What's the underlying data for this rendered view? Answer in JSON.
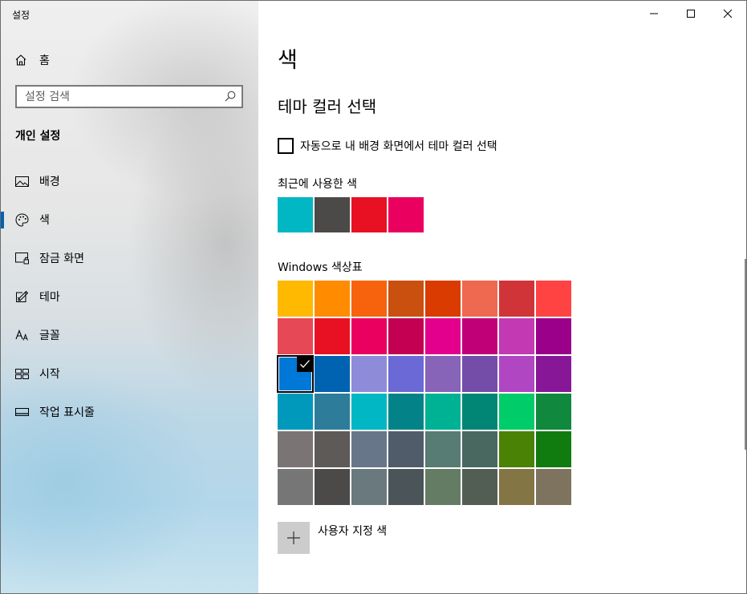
{
  "window": {
    "app_title": "설정"
  },
  "sidebar": {
    "home_label": "홈",
    "search": {
      "placeholder": "설정 검색"
    },
    "section_title": "개인 설정",
    "items": [
      {
        "label": "배경",
        "icon": "image-icon"
      },
      {
        "label": "색",
        "icon": "palette-icon",
        "active": true
      },
      {
        "label": "잠금 화면",
        "icon": "lock-screen-icon"
      },
      {
        "label": "테마",
        "icon": "theme-icon"
      },
      {
        "label": "글꼴",
        "icon": "font-icon"
      },
      {
        "label": "시작",
        "icon": "start-icon"
      },
      {
        "label": "작업 표시줄",
        "icon": "taskbar-icon"
      }
    ],
    "accent_color": "#0063b1"
  },
  "main": {
    "page_title": "색",
    "sub_title": "테마 컬러 선택",
    "auto_pick": {
      "label": "자동으로 내 배경 화면에서 테마 컬러 선택",
      "checked": false
    },
    "recent_label": "최근에 사용한 색",
    "recent_colors": [
      "#00b7c3",
      "#4c4a48",
      "#e81123",
      "#ea005e"
    ],
    "palette_label": "Windows 색상표",
    "palette": [
      [
        "#ffb900",
        "#ff8c00",
        "#f7630c",
        "#ca5010",
        "#da3b01",
        "#ef6950",
        "#d13438",
        "#ff4343"
      ],
      [
        "#e74856",
        "#e81123",
        "#ea005e",
        "#c30052",
        "#e3008c",
        "#bf0077",
        "#c239b3",
        "#9a0089"
      ],
      [
        "#0078d7",
        "#0063b1",
        "#8e8cd8",
        "#6b69d6",
        "#8764b8",
        "#744da9",
        "#b146c2",
        "#881798"
      ],
      [
        "#0099bc",
        "#2d7d9a",
        "#00b7c3",
        "#038387",
        "#00b294",
        "#018574",
        "#00cc6a",
        "#10893e"
      ],
      [
        "#7a7574",
        "#5d5a58",
        "#68768a",
        "#515c6b",
        "#567c73",
        "#486860",
        "#498205",
        "#107c10"
      ],
      [
        "#767676",
        "#4c4a48",
        "#69797e",
        "#4a5459",
        "#647c64",
        "#525e54",
        "#847545",
        "#7e735f"
      ]
    ],
    "selected": {
      "row": 2,
      "col": 0
    },
    "custom_label": "사용자 지정 색"
  }
}
